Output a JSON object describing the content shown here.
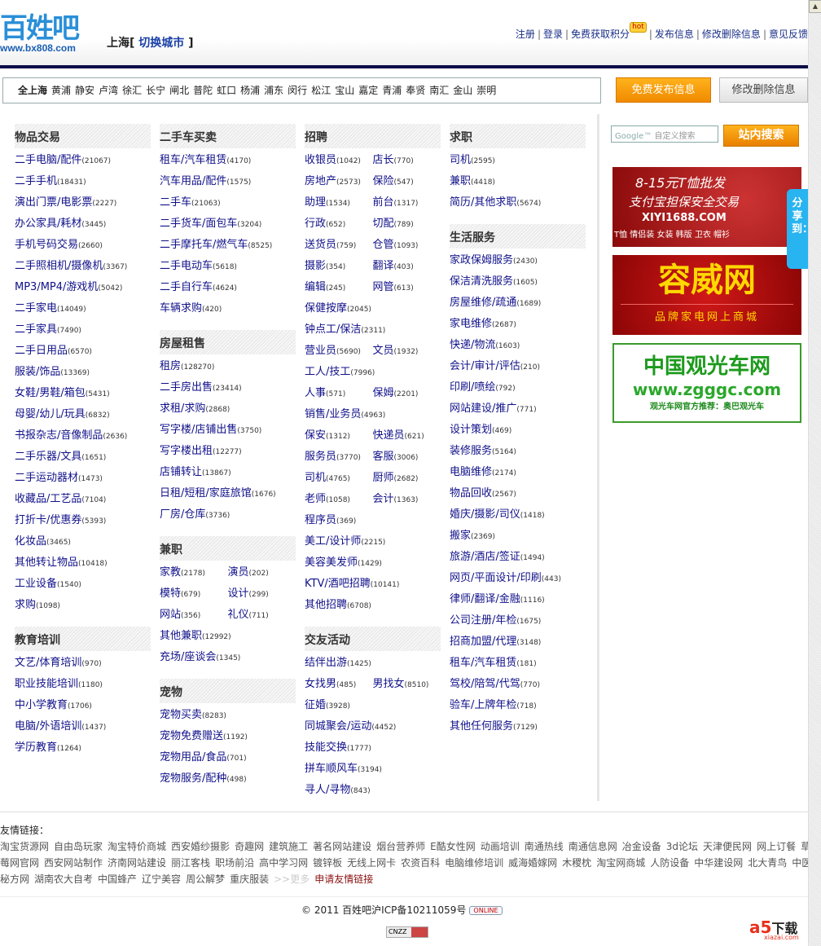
{
  "header": {
    "logo_cn": "百姓吧",
    "logo_url": "www.bx808.com",
    "city": "上海",
    "switch_city": "切换城市",
    "top_links": [
      "注册",
      "登录",
      "免费获取积分",
      "发布信息",
      "修改删除信息",
      "意见反馈"
    ],
    "hot_badge": "hot"
  },
  "districts": [
    "全上海",
    "黄浦",
    "静安",
    "卢湾",
    "徐汇",
    "长宁",
    "闸北",
    "普陀",
    "虹口",
    "杨浦",
    "浦东",
    "闵行",
    "松江",
    "宝山",
    "嘉定",
    "青浦",
    "奉贤",
    "南汇",
    "金山",
    "崇明"
  ],
  "buttons": {
    "post": "免费发布信息",
    "edit": "修改删除信息",
    "search": "站内搜索"
  },
  "search": {
    "placeholder_brand": "Google™",
    "placeholder": "自定义搜索"
  },
  "columns": [
    [
      {
        "title": "物品交易",
        "rows": [
          [
            [
              "二手电脑/配件",
              "(21067)"
            ]
          ],
          [
            [
              "二手手机",
              "(18431)"
            ]
          ],
          [
            [
              "演出门票/电影票",
              "(2227)"
            ]
          ],
          [
            [
              "办公家具/耗材",
              "(3445)"
            ]
          ],
          [
            [
              "手机号码交易",
              "(2660)"
            ]
          ],
          [
            [
              "二手照相机/摄像机",
              "(3367)"
            ]
          ],
          [
            [
              "MP3/MP4/游戏机",
              "(5042)"
            ]
          ],
          [
            [
              "二手家电",
              "(14049)"
            ]
          ],
          [
            [
              "二手家具",
              "(7490)"
            ]
          ],
          [
            [
              "二手日用品",
              "(6570)"
            ]
          ],
          [
            [
              "服装/饰品",
              "(13369)"
            ]
          ],
          [
            [
              "女鞋/男鞋/箱包",
              "(5431)"
            ]
          ],
          [
            [
              "母婴/幼儿/玩具",
              "(6832)"
            ]
          ],
          [
            [
              "书报杂志/音像制品",
              "(2636)"
            ]
          ],
          [
            [
              "二手乐器/文具",
              "(1651)"
            ]
          ],
          [
            [
              "二手运动器材",
              "(1473)"
            ]
          ],
          [
            [
              "收藏品/工艺品",
              "(7104)"
            ]
          ],
          [
            [
              "打折卡/优惠券",
              "(5393)"
            ]
          ],
          [
            [
              "化妆品",
              "(3465)"
            ]
          ],
          [
            [
              "其他转让物品",
              "(10418)"
            ]
          ],
          [
            [
              "工业设备",
              "(1540)"
            ]
          ],
          [
            [
              "求购",
              "(1098)"
            ]
          ]
        ]
      },
      {
        "title": "教育培训",
        "rows": [
          [
            [
              "文艺/体育培训",
              "(970)"
            ]
          ],
          [
            [
              "职业技能培训",
              "(1180)"
            ]
          ],
          [
            [
              "中小学教育",
              "(1706)"
            ]
          ],
          [
            [
              "电脑/外语培训",
              "(1437)"
            ]
          ],
          [
            [
              "学历教育",
              "(1264)"
            ]
          ]
        ]
      }
    ],
    [
      {
        "title": "二手车买卖",
        "rows": [
          [
            [
              "租车/汽车租赁",
              "(4170)"
            ]
          ],
          [
            [
              "汽车用品/配件",
              "(1575)"
            ]
          ],
          [
            [
              "二手车",
              "(21063)"
            ]
          ],
          [
            [
              "二手货车/面包车",
              "(3204)"
            ]
          ],
          [
            [
              "二手摩托车/燃气车",
              "(8525)"
            ]
          ],
          [
            [
              "二手电动车",
              "(5618)"
            ]
          ],
          [
            [
              "二手自行车",
              "(4624)"
            ]
          ],
          [
            [
              "车辆求购",
              "(420)"
            ]
          ]
        ]
      },
      {
        "title": "房屋租售",
        "rows": [
          [
            [
              "租房",
              "(128270)"
            ]
          ],
          [
            [
              "二手房出售",
              "(23414)"
            ]
          ],
          [
            [
              "求租/求购",
              "(2868)"
            ]
          ],
          [
            [
              "写字楼/店铺出售",
              "(3750)"
            ]
          ],
          [
            [
              "写字楼出租",
              "(12277)"
            ]
          ],
          [
            [
              "店铺转让",
              "(13867)"
            ]
          ],
          [
            [
              "日租/短租/家庭旅馆",
              "(1676)"
            ]
          ],
          [
            [
              "厂房/仓库",
              "(3736)"
            ]
          ]
        ]
      },
      {
        "title": "兼职",
        "rows": [
          [
            [
              "家教",
              "(2178)"
            ],
            [
              "演员",
              "(202)"
            ]
          ],
          [
            [
              "模特",
              "(679)"
            ],
            [
              "设计",
              "(299)"
            ]
          ],
          [
            [
              "网站",
              "(356)"
            ],
            [
              "礼仪",
              "(711)"
            ]
          ],
          [
            [
              "其他兼职",
              "(12992)"
            ]
          ],
          [
            [
              "充场/座谈会",
              "(1345)"
            ]
          ]
        ]
      },
      {
        "title": "宠物",
        "rows": [
          [
            [
              "宠物买卖",
              "(8283)"
            ]
          ],
          [
            [
              "宠物免费赠送",
              "(1192)"
            ]
          ],
          [
            [
              "宠物用品/食品",
              "(701)"
            ]
          ],
          [
            [
              "宠物服务/配种",
              "(498)"
            ]
          ]
        ]
      }
    ],
    [
      {
        "title": "招聘",
        "rows": [
          [
            [
              "收银员",
              "(1042)"
            ],
            [
              "店长",
              "(770)"
            ]
          ],
          [
            [
              "房地产",
              "(2573)"
            ],
            [
              "保险",
              "(547)"
            ]
          ],
          [
            [
              "助理",
              "(1534)"
            ],
            [
              "前台",
              "(1317)"
            ]
          ],
          [
            [
              "行政",
              "(652)"
            ],
            [
              "切配",
              "(789)"
            ]
          ],
          [
            [
              "送货员",
              "(759)"
            ],
            [
              "仓管",
              "(1093)"
            ]
          ],
          [
            [
              "摄影",
              "(354)"
            ],
            [
              "翻译",
              "(403)"
            ]
          ],
          [
            [
              "编辑",
              "(245)"
            ],
            [
              "网管",
              "(613)"
            ]
          ],
          [
            [
              "保健按摩",
              "(2045)"
            ]
          ],
          [
            [
              "钟点工/保洁",
              "(2311)"
            ]
          ],
          [
            [
              "营业员",
              "(5690)"
            ],
            [
              "文员",
              "(1932)"
            ]
          ],
          [
            [
              "工人/技工",
              "(7996)"
            ]
          ],
          [
            [
              "人事",
              "(571)"
            ],
            [
              "保姆",
              "(2201)"
            ]
          ],
          [
            [
              "销售/业务员",
              "(4963)"
            ]
          ],
          [
            [
              "保安",
              "(1312)"
            ],
            [
              "快递员",
              "(621)"
            ]
          ],
          [
            [
              "服务员",
              "(3770)"
            ],
            [
              "客服",
              "(3006)"
            ]
          ],
          [
            [
              "司机",
              "(4765)"
            ],
            [
              "厨师",
              "(2682)"
            ]
          ],
          [
            [
              "老师",
              "(1058)"
            ],
            [
              "会计",
              "(1363)"
            ]
          ],
          [
            [
              "程序员",
              "(369)"
            ]
          ],
          [
            [
              "美工/设计师",
              "(2215)"
            ]
          ],
          [
            [
              "美容美发师",
              "(1429)"
            ]
          ],
          [
            [
              "KTV/酒吧招聘",
              "(10141)"
            ]
          ],
          [
            [
              "其他招聘",
              "(6708)"
            ]
          ]
        ]
      },
      {
        "title": "交友活动",
        "rows": [
          [
            [
              "结伴出游",
              "(1425)"
            ]
          ],
          [
            [
              "女找男",
              "(485)"
            ],
            [
              "男找女",
              "(8510)"
            ]
          ],
          [
            [
              "征婚",
              "(3928)"
            ]
          ],
          [
            [
              "同城聚会/运动",
              "(4452)"
            ]
          ],
          [
            [
              "技能交换",
              "(1777)"
            ]
          ],
          [
            [
              "拼车顺风车",
              "(3194)"
            ]
          ],
          [
            [
              "寻人/寻物",
              "(843)"
            ]
          ]
        ]
      }
    ],
    [
      {
        "title": "求职",
        "rows": [
          [
            [
              "司机",
              "(2595)"
            ]
          ],
          [
            [
              "兼职",
              "(4418)"
            ]
          ],
          [
            [
              "简历/其他求职",
              "(5674)"
            ]
          ]
        ]
      },
      {
        "title": "生活服务",
        "rows": [
          [
            [
              "家政保姆服务",
              "(2430)"
            ]
          ],
          [
            [
              "保洁清洗服务",
              "(1605)"
            ]
          ],
          [
            [
              "房屋维修/疏通",
              "(1689)"
            ]
          ],
          [
            [
              "家电维修",
              "(2687)"
            ]
          ],
          [
            [
              "快递/物流",
              "(1603)"
            ]
          ],
          [
            [
              "会计/审计/评估",
              "(210)"
            ]
          ],
          [
            [
              "印刷/喷绘",
              "(792)"
            ]
          ],
          [
            [
              "网站建设/推广",
              "(771)"
            ]
          ],
          [
            [
              "设计策划",
              "(469)"
            ]
          ],
          [
            [
              "装修服务",
              "(5164)"
            ]
          ],
          [
            [
              "电脑维修",
              "(2174)"
            ]
          ],
          [
            [
              "物品回收",
              "(2567)"
            ]
          ],
          [
            [
              "婚庆/摄影/司仪",
              "(1418)"
            ]
          ],
          [
            [
              "搬家",
              "(2369)"
            ]
          ],
          [
            [
              "旅游/酒店/签证",
              "(1494)"
            ]
          ],
          [
            [
              "网页/平面设计/印刷",
              "(443)"
            ]
          ],
          [
            [
              "律师/翻译/金融",
              "(1116)"
            ]
          ],
          [
            [
              "公司注册/年检",
              "(1675)"
            ]
          ],
          [
            [
              "招商加盟/代理",
              "(3148)"
            ]
          ],
          [
            [
              "租车/汽车租赁",
              "(181)"
            ]
          ],
          [
            [
              "驾校/陪驾/代驾",
              "(770)"
            ]
          ],
          [
            [
              "验车/上牌年检",
              "(718)"
            ]
          ],
          [
            [
              "其他任何服务",
              "(7129)"
            ]
          ]
        ]
      }
    ]
  ],
  "ads": {
    "ad1": {
      "line1": "8-15元T恤批发",
      "line2": "支付宝担保安全交易",
      "line3": "XIYI1688.COM",
      "line4": "T恤 情侣装 女装 韩版 卫衣 帽衫"
    },
    "ad2": {
      "big": "容威网",
      "small": "品牌家电网上商城"
    },
    "ad3": {
      "big": "中国观光车网",
      "url": "www.zgggc.com",
      "small": "观光车网官方推荐：奥巴观光车"
    }
  },
  "share": "分享到：",
  "friend_links": {
    "title": "友情链接：",
    "rows": [
      [
        "淘宝货源网",
        "自由岛玩家",
        "淘宝特价商城",
        "西安婚纱摄影",
        "奇趣网",
        "建筑施工",
        "著名网站建设",
        "烟台营养师",
        "E酷女性网",
        "动画培训",
        "南通热线",
        "南通信息网",
        "冶金设备",
        "3d论坛",
        "天津便民网",
        "网上订餐",
        "草"
      ],
      [
        "莓网官网",
        "西安网站制作",
        "济南网站建设",
        "丽江客栈",
        "职场前沿",
        "高中学习网",
        "镀锌板",
        "无线上网卡",
        "农资百科",
        "电脑维修培训",
        "威海婚嫁网",
        "木稷枕",
        "淘宝网商城",
        "人防设备",
        "中华建设网",
        "北大青鸟",
        "中医"
      ],
      [
        "秘方网",
        "湖南农大自考",
        "中国蜂产",
        "辽宁美容",
        "周公解梦",
        "重庆服装"
      ]
    ],
    "more": ">>更多",
    "apply": "申请友情链接"
  },
  "footer": {
    "copyright": "© 2011 百姓吧沪ICP备10211059号",
    "qq_badge": "ONLINE",
    "cnzz": "CNZZ",
    "a5_logo": "a5",
    "a5_text": "下载",
    "a5_sub": "xiazai.com"
  }
}
